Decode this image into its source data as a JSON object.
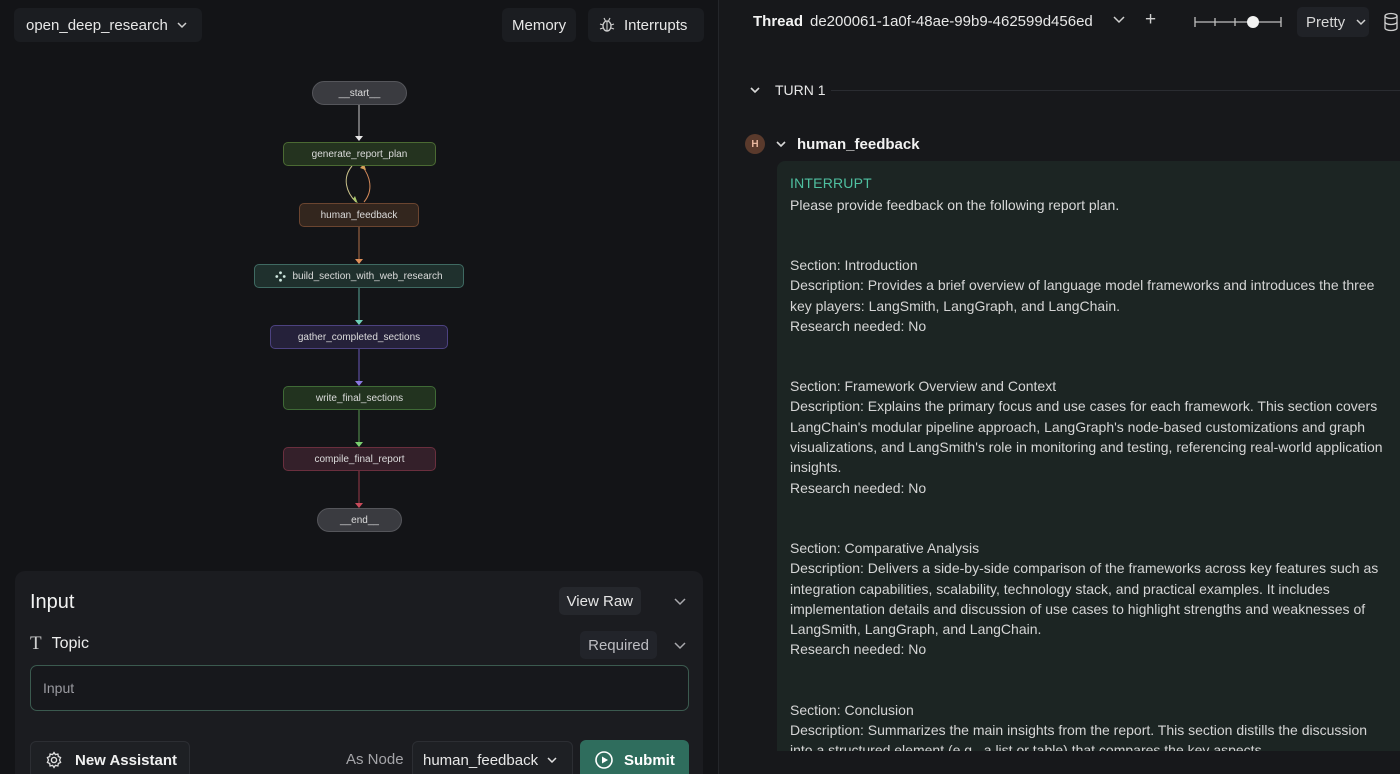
{
  "header": {
    "assistant_name": "open_deep_research",
    "memory_label": "Memory",
    "interrupts_label": "Interrupts"
  },
  "graph": {
    "nodes": [
      {
        "id": "start",
        "label": "__start__"
      },
      {
        "id": "generate_report_plan",
        "label": "generate_report_plan"
      },
      {
        "id": "human_feedback",
        "label": "human_feedback"
      },
      {
        "id": "build_section_with_web_research",
        "label": "build_section_with_web_research"
      },
      {
        "id": "gather_completed_sections",
        "label": "gather_completed_sections"
      },
      {
        "id": "write_final_sections",
        "label": "write_final_sections"
      },
      {
        "id": "compile_final_report",
        "label": "compile_final_report"
      },
      {
        "id": "end",
        "label": "__end__"
      }
    ]
  },
  "input_panel": {
    "title": "Input",
    "view_raw_label": "View Raw",
    "field_label": "Topic",
    "required_label": "Required",
    "placeholder": "Input",
    "new_assistant_label": "New Assistant",
    "as_node_label": "As Node",
    "as_node_value": "human_feedback",
    "submit_label": "Submit"
  },
  "thread": {
    "label": "Thread",
    "id": "de200061-1a0f-48ae-99b9-462599d456ed",
    "view_mode": "Pretty"
  },
  "turn": {
    "label": "TURN 1",
    "node_badge": "H",
    "node_name": "human_feedback",
    "interrupt_label": "INTERRUPT",
    "intro": "Please provide feedback on the following report plan.",
    "sections": [
      {
        "section": "Section: Introduction",
        "description": "Description: Provides a brief overview of language model frameworks and introduces the three key players: LangSmith, LangGraph, and LangChain.",
        "research": "Research needed: No"
      },
      {
        "section": "Section: Framework Overview and Context",
        "description": "Description: Explains the primary focus and use cases for each framework. This section covers LangChain's modular pipeline approach, LangGraph's node-based customizations and graph visualizations, and LangSmith's role in monitoring and testing, referencing real-world application insights.",
        "research": "Research needed: No"
      },
      {
        "section": "Section: Comparative Analysis",
        "description": "Description: Delivers a side-by-side comparison of the frameworks across key features such as integration capabilities, scalability, technology stack, and practical examples. It includes implementation details and discussion of use cases to highlight strengths and weaknesses of LangSmith, LangGraph, and LangChain.",
        "research": "Research needed: No"
      },
      {
        "section": "Section: Conclusion",
        "description": "Description: Summarizes the main insights from the report. This section distills the discussion into a structured element (e.g., a list or table) that compares the key aspects",
        "research": ""
      }
    ]
  },
  "colors": {
    "accent": "#2f6d5d",
    "interrupt_text": "#4fc0a0",
    "background": "#131417"
  }
}
